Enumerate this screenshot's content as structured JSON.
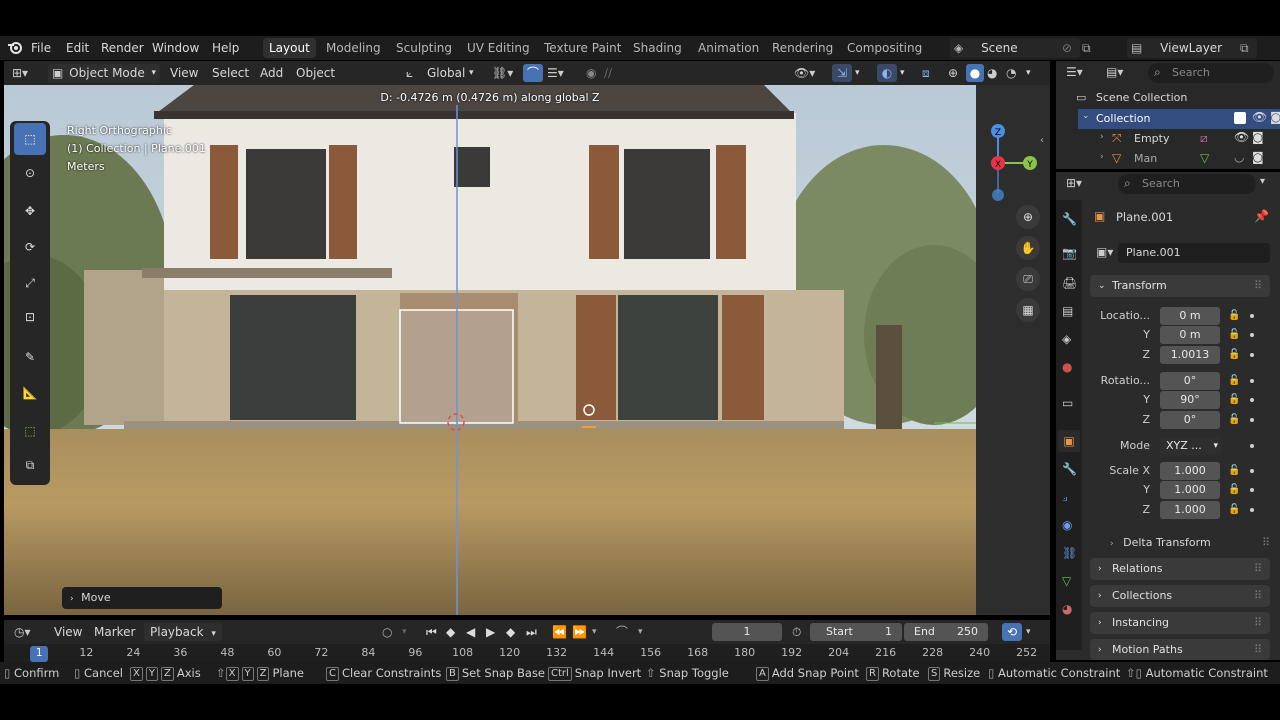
{
  "menubar": {
    "file": "File",
    "edit": "Edit",
    "render": "Render",
    "window": "Window",
    "help": "Help",
    "workspaces": [
      "Layout",
      "Modeling",
      "Sculpting",
      "UV Editing",
      "Texture Paint",
      "Shading",
      "Animation",
      "Rendering",
      "Compositing"
    ],
    "scene": "Scene",
    "view_layer": "ViewLayer"
  },
  "viewport_header": {
    "mode": "Object Mode",
    "view": "View",
    "select": "Select",
    "add": "Add",
    "object": "Object",
    "orientation": "Global"
  },
  "viewport": {
    "status_line": "D: -0.4726 m (0.4726 m) along global Z",
    "view_name": "Right Orthographic",
    "collection_info": "(1) Collection | Plane.001",
    "units": "Meters",
    "operator_panel": "Move",
    "gizmo": {
      "z": "Z",
      "y": "Y",
      "x": "X"
    }
  },
  "outliner": {
    "search_placeholder": "Search",
    "scene_collection": "Scene Collection",
    "collection": "Collection",
    "items": [
      "Empty",
      "Man"
    ]
  },
  "properties": {
    "search_placeholder": "Search",
    "object_name": "Plane.001",
    "datablock_name": "Plane.001",
    "transform": "Transform",
    "location_label": "Locatio...",
    "location": {
      "x": "0 m",
      "y": "0 m",
      "z": "1.0013"
    },
    "rotation_label": "Rotatio...",
    "rotation": {
      "x": "0°",
      "y": "90°",
      "z": "0°"
    },
    "mode_label": "Mode",
    "mode_value": "XYZ ...",
    "scale_label": "Scale X",
    "scale": {
      "x": "1.000",
      "y": "1.000",
      "z": "1.000"
    },
    "axis_y": "Y",
    "axis_z": "Z",
    "panels": [
      "Delta Transform",
      "Relations",
      "Collections",
      "Instancing",
      "Motion Paths"
    ]
  },
  "timeline": {
    "view": "View",
    "marker": "Marker",
    "playback": "Playback",
    "current_frame": "1",
    "start_label": "Start",
    "start": "1",
    "end_label": "End",
    "end": "250",
    "ruler": [
      "1",
      "12",
      "24",
      "36",
      "48",
      "60",
      "72",
      "84",
      "96",
      "108",
      "120",
      "132",
      "144",
      "156",
      "168",
      "180",
      "192",
      "204",
      "216",
      "228",
      "240",
      "252"
    ]
  },
  "statusbar": {
    "confirm": "Confirm",
    "cancel": "Cancel",
    "axis": "Axis",
    "plane": "Plane",
    "clear_constraints": "Clear Constraints",
    "set_snap_base": "Set Snap Base",
    "snap_invert": "Snap Invert",
    "snap_toggle": "Snap Toggle",
    "add_snap_point": "Add Snap Point",
    "rotate": "Rotate",
    "resize": "Resize",
    "automatic_constraint": "Automatic Constraint",
    "automatic_constraint_2": "Automatic Constraint",
    "keys": {
      "x": "X",
      "y": "Y",
      "z": "Z",
      "c": "C",
      "b": "B",
      "ctrl": "Ctrl",
      "a": "A",
      "r": "R",
      "s": "S"
    }
  },
  "colors": {
    "accent": "#4772b3",
    "x_axis": "#e8344a",
    "y_axis": "#8bc34a",
    "z_axis": "#4a90e2",
    "background": "#1d1d1d"
  }
}
